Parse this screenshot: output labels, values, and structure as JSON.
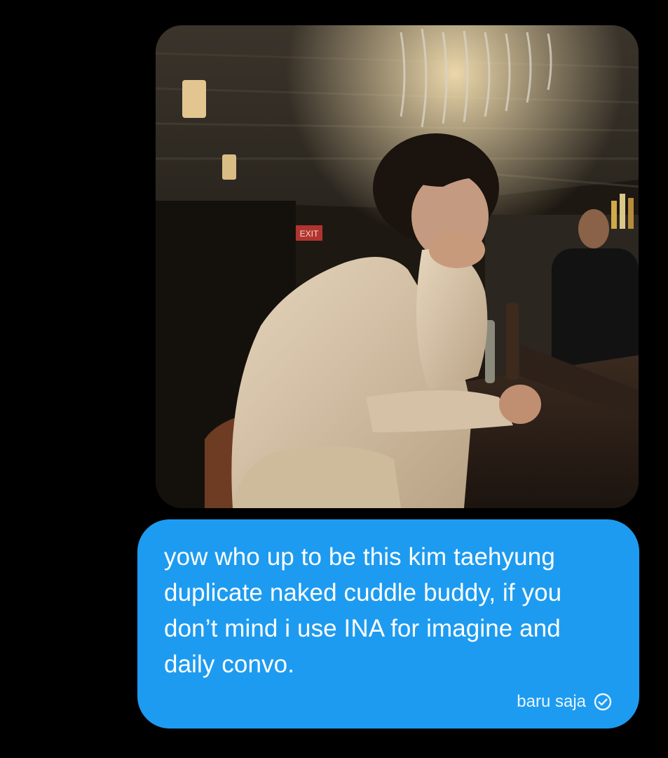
{
  "message": {
    "photo": {
      "alt": "photo attachment",
      "exit_sign_text": "EXIT"
    },
    "text": "yow who up to be this kim taehyung duplicate naked cuddle buddy, if you don’t mind i use INA for imagine and daily convo.",
    "timestamp": "baru saja",
    "status_icon": "check-circle-icon"
  },
  "colors": {
    "background": "#000000",
    "bubble": "#1d9bf0",
    "text": "#ffffff"
  }
}
